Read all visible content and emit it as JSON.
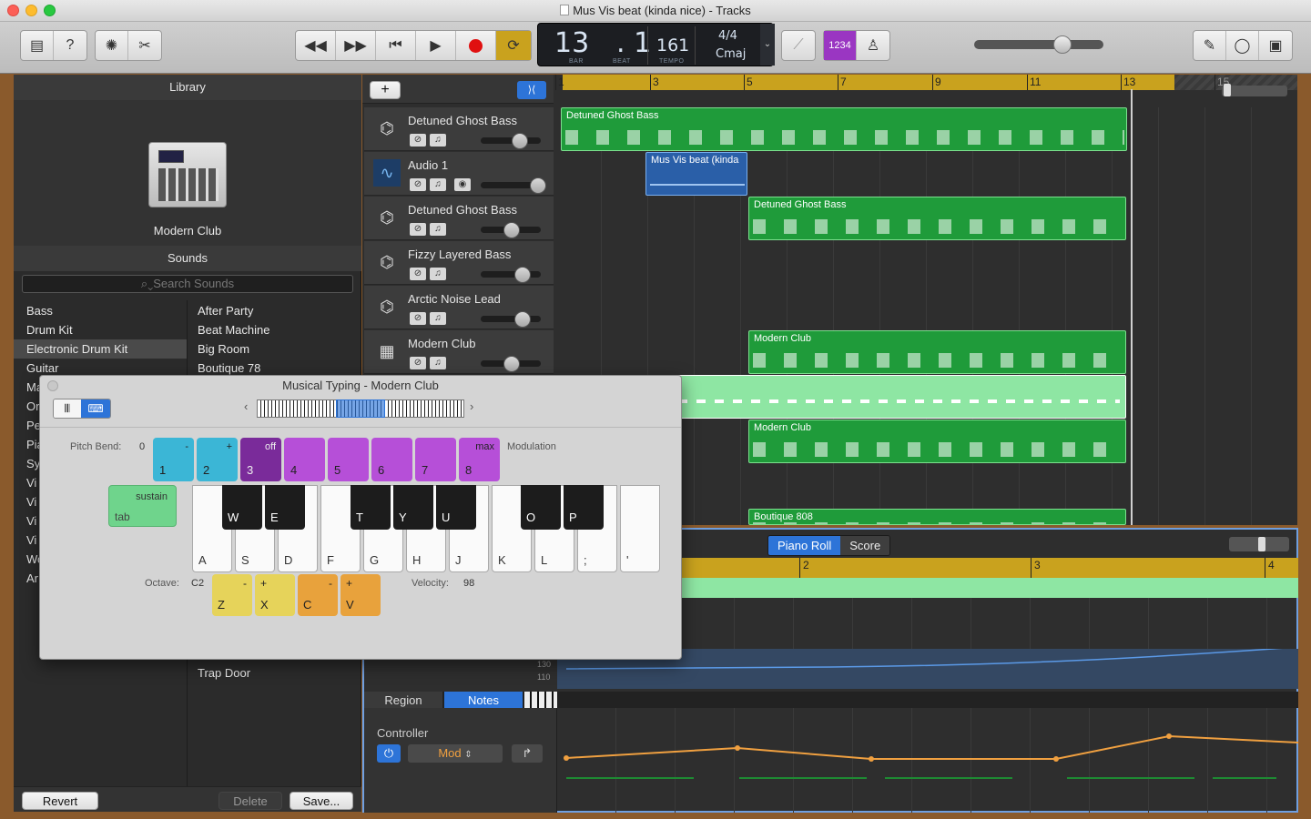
{
  "window": {
    "title": "Mus Vis beat (kinda nice) - Tracks"
  },
  "toolbar": {
    "icons": [
      "library-icon",
      "help-icon",
      "smart-controls-icon",
      "editors-icon",
      "rewind-icon",
      "fast-forward-icon",
      "go-to-start-icon",
      "play-icon",
      "record-icon",
      "cycle-icon",
      "tuner-icon",
      "count-in-icon",
      "metronome-icon",
      "notepad-icon",
      "loop-browser-icon",
      "media-browser-icon"
    ],
    "count_in_label": "1234"
  },
  "lcd": {
    "bar": "13",
    "beat": "1",
    "bar_label": "BAR",
    "beat_label": "BEAT",
    "tempo": "161",
    "tempo_label": "TEMPO",
    "signature": "4/4",
    "key": "Cmaj"
  },
  "master_volume": {
    "level": 0.68
  },
  "library": {
    "title": "Library",
    "patch_name": "Modern Club",
    "sounds_title": "Sounds",
    "search_placeholder": "Search Sounds",
    "categories": [
      {
        "label": "Bass"
      },
      {
        "label": "Drum Kit"
      },
      {
        "label": "Electronic Drum Kit"
      },
      {
        "label": "Guitar"
      },
      {
        "label": "Ma"
      },
      {
        "label": "Or"
      },
      {
        "label": "Pe"
      },
      {
        "label": "Pia"
      },
      {
        "label": "Sy"
      },
      {
        "label": "Vi"
      },
      {
        "label": "Vi"
      },
      {
        "label": "Vi"
      },
      {
        "label": "Vi"
      },
      {
        "label": "Wo"
      },
      {
        "label": "Ar"
      }
    ],
    "patches": [
      {
        "label": "After Party"
      },
      {
        "label": "Beat Machine"
      },
      {
        "label": "Big Room"
      },
      {
        "label": "Boutique 78"
      },
      {
        "label": "Trap Door"
      }
    ],
    "revert_label": "Revert",
    "delete_label": "Delete",
    "save_label": "Save..."
  },
  "tracks": {
    "add_label": "+",
    "ruler": [
      "1",
      "3",
      "5",
      "7",
      "9",
      "11",
      "13",
      "15"
    ],
    "list": [
      {
        "name": "Detuned Ghost Bass",
        "volume": 0.65
      },
      {
        "name": "Audio 1",
        "volume": 0.95
      },
      {
        "name": "Detuned Ghost Bass",
        "volume": 0.52
      },
      {
        "name": "Fizzy Layered Bass",
        "volume": 0.7
      },
      {
        "name": "Arctic Noise Lead",
        "volume": 0.7
      },
      {
        "name": "Modern Club",
        "volume": 0.52
      }
    ],
    "regions": [
      {
        "label": "Detuned Ghost Bass"
      },
      {
        "label": "Mus Vis beat (kinda"
      },
      {
        "label": "Detuned Ghost Bass"
      },
      {
        "label": "Modern Club"
      },
      {
        "label": "Modern Club"
      },
      {
        "label": "Boutique 808"
      }
    ]
  },
  "editor": {
    "piano_roll_label": "Piano Roll",
    "score_label": "Score",
    "ruler": [
      "2",
      "3",
      "4"
    ],
    "region_tab": "Region",
    "notes_tab": "Notes",
    "tempo_scale": [
      "130",
      "110"
    ],
    "controller_label": "Controller",
    "controller_value": "Mod"
  },
  "musical_typing": {
    "title": "Musical Typing - Modern Club",
    "pitch_bend_label": "Pitch Bend:",
    "pitch_bend_value": "0",
    "modulation_label": "Modulation",
    "top_keys": [
      {
        "top": "-",
        "bottom": "1"
      },
      {
        "top": "+",
        "bottom": "2"
      },
      {
        "top": "off",
        "bottom": "3"
      },
      {
        "top": "",
        "bottom": "4"
      },
      {
        "top": "",
        "bottom": "5"
      },
      {
        "top": "",
        "bottom": "6"
      },
      {
        "top": "",
        "bottom": "7"
      },
      {
        "top": "max",
        "bottom": "8"
      }
    ],
    "sustain_label": "sustain",
    "tab_label": "tab",
    "white_keys": [
      "A",
      "S",
      "D",
      "F",
      "G",
      "H",
      "J",
      "K",
      "L",
      ";",
      "'"
    ],
    "black_keys": [
      "W",
      "E",
      "T",
      "Y",
      "U",
      "O",
      "P"
    ],
    "octave_label": "Octave:",
    "octave_value": "C2",
    "octave_keys": [
      {
        "top": "-",
        "bottom": "Z"
      },
      {
        "top": "+",
        "bottom": "X"
      },
      {
        "top": "-",
        "bottom": "C"
      },
      {
        "top": "+",
        "bottom": "V"
      }
    ],
    "velocity_label": "Velocity:",
    "velocity_value": "98"
  }
}
